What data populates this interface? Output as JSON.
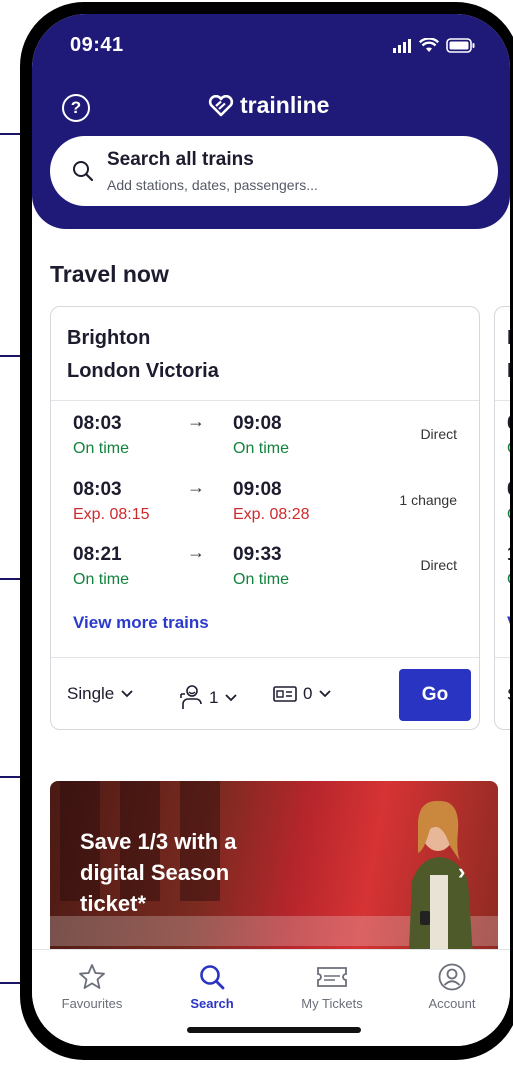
{
  "status_bar": {
    "time": "09:41"
  },
  "header": {
    "help_icon": "question-circle-icon",
    "brand": "trainline",
    "search": {
      "title": "Search all trains",
      "subtitle": "Add stations, dates, passengers..."
    }
  },
  "travel_now": {
    "title": "Travel now",
    "card": {
      "origin": "Brighton",
      "destination": "London Victoria",
      "services": [
        {
          "dep": "08:03",
          "dep_status": "On time",
          "arr": "09:08",
          "arr_status": "On time",
          "changes": "Direct",
          "status_color": "#12823e"
        },
        {
          "dep": "08:03",
          "dep_status": "Exp. 08:15",
          "arr": "09:08",
          "arr_status": "Exp. 08:28",
          "changes": "1 change",
          "status_color": "#cf2a2a"
        },
        {
          "dep": "08:21",
          "dep_status": "On time",
          "arr": "09:33",
          "arr_status": "On time",
          "changes": "Direct",
          "status_color": "#12823e"
        }
      ],
      "view_more": "View more trains",
      "arrow": "→",
      "ticket_type": "Single",
      "passengers": "1",
      "railcards": "0",
      "go": "Go"
    },
    "next_card": {
      "route_initials": [
        "E",
        "F"
      ],
      "times_initial": [
        "0",
        "0",
        "1"
      ],
      "status_initial": "O",
      "link_initial": "V",
      "ticket_initial": "S"
    }
  },
  "promo": {
    "text": "Save 1/3 with a digital Season ticket*",
    "chevron": "›"
  },
  "tabs": [
    {
      "label": "Favourites",
      "icon": "star-icon",
      "active": false
    },
    {
      "label": "Search",
      "icon": "search-icon",
      "active": true
    },
    {
      "label": "My Tickets",
      "icon": "ticket-icon",
      "active": false
    },
    {
      "label": "Account",
      "icon": "account-icon",
      "active": false
    }
  ],
  "colors": {
    "brand": "#1f1a78",
    "accent": "#2a34c2",
    "on_time": "#12823e",
    "delayed": "#cf2a2a"
  }
}
